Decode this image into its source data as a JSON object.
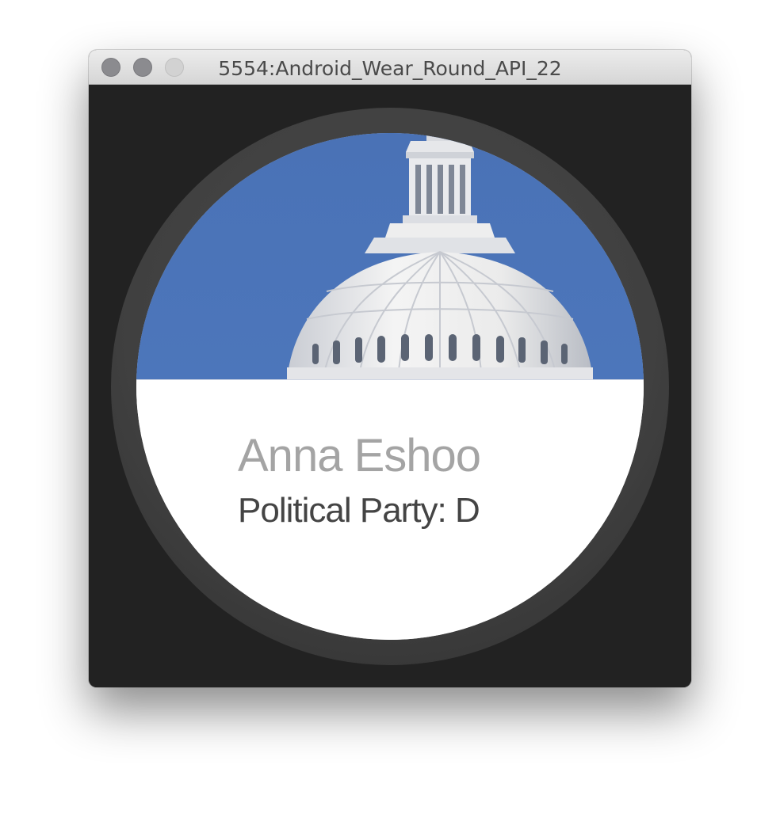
{
  "window": {
    "title": "5554:Android_Wear_Round_API_22"
  },
  "card": {
    "name": "Anna Eshoo",
    "party": "Political Party: D"
  },
  "colors": {
    "sky": "#4a73b8",
    "bezel": "#404040",
    "background": "#222222",
    "name_text": "#a4a4a4",
    "party_text": "#444444"
  },
  "icons": {
    "close": "close-icon",
    "minimize": "minimize-icon",
    "zoom": "zoom-icon"
  }
}
